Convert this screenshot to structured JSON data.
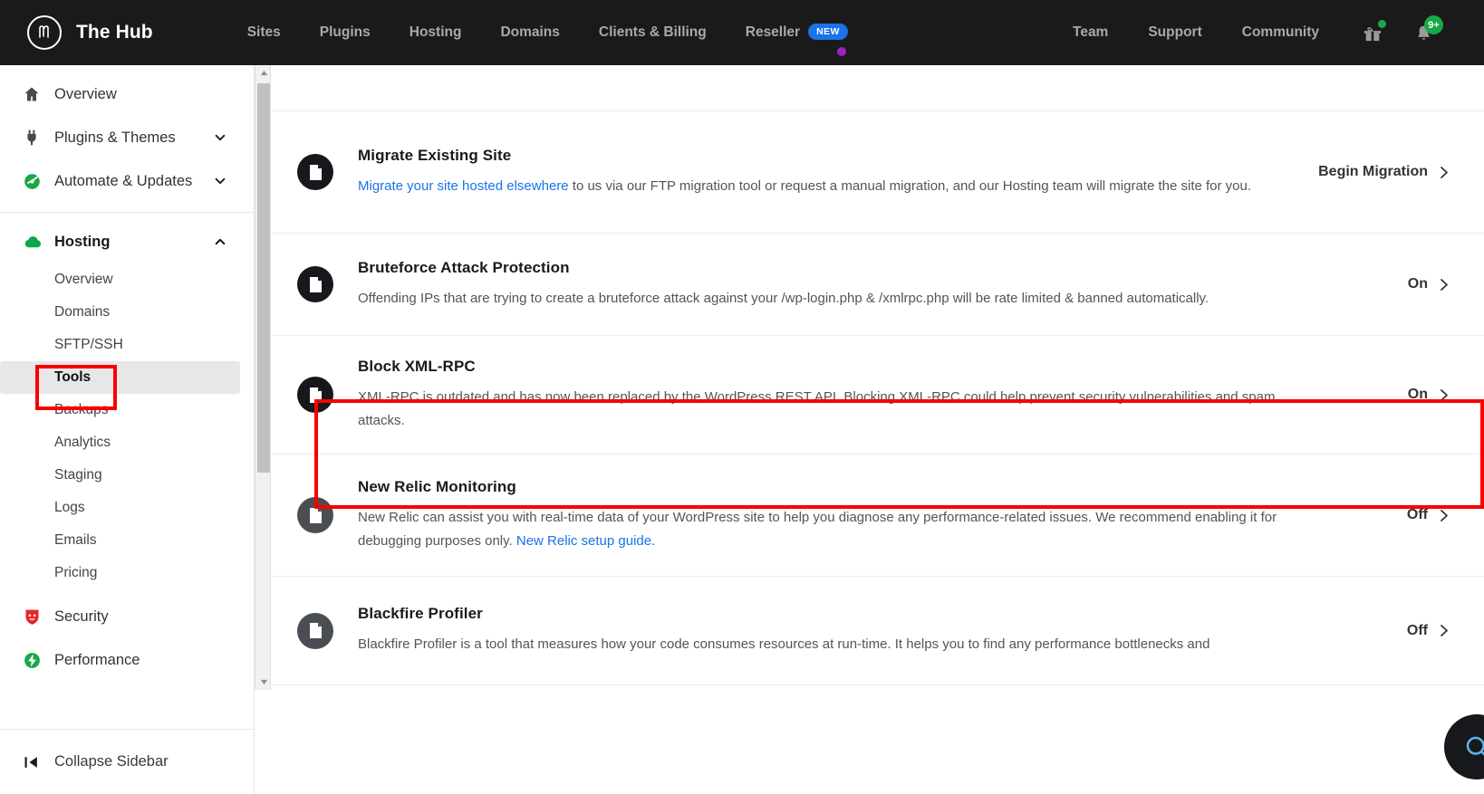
{
  "header": {
    "brand": "The Hub",
    "logo_icon": "hub-logo-icon",
    "nav": [
      {
        "label": "Sites"
      },
      {
        "label": "Plugins"
      },
      {
        "label": "Hosting"
      },
      {
        "label": "Domains"
      },
      {
        "label": "Clients & Billing"
      },
      {
        "label": "Reseller",
        "badge": "NEW",
        "dot": true
      }
    ],
    "nav_right": [
      {
        "label": "Team"
      },
      {
        "label": "Support"
      },
      {
        "label": "Community"
      }
    ],
    "gift_icon": "gift-icon",
    "bell_icon": "bell-icon",
    "notification_count": "9+",
    "menu_icon": "hamburger-menu-icon",
    "bg_color": "#1a1a1a",
    "badge_color": "#1a73e8",
    "notification_color": "#17a948"
  },
  "sidebar": {
    "top_items": [
      {
        "label": "Overview",
        "icon": "home-icon",
        "chevron": null
      },
      {
        "label": "Plugins & Themes",
        "icon": "plug-icon",
        "chevron": "chevron-down-icon"
      },
      {
        "label": "Automate & Updates",
        "icon": "automate-icon",
        "chevron": "chevron-down-icon"
      }
    ],
    "hosting": {
      "label": "Hosting",
      "icon": "cloud-icon",
      "chevron": "chevron-up-icon",
      "sub_items": [
        {
          "label": "Overview",
          "active": false
        },
        {
          "label": "Domains",
          "active": false
        },
        {
          "label": "SFTP/SSH",
          "active": false
        },
        {
          "label": "Tools",
          "active": true
        },
        {
          "label": "Backups",
          "active": false
        },
        {
          "label": "Analytics",
          "active": false
        },
        {
          "label": "Staging",
          "active": false
        },
        {
          "label": "Logs",
          "active": false
        },
        {
          "label": "Emails",
          "active": false
        },
        {
          "label": "Pricing",
          "active": false
        }
      ]
    },
    "bottom_items": [
      {
        "label": "Security",
        "icon": "shield-icon"
      },
      {
        "label": "Performance",
        "icon": "performance-icon"
      }
    ],
    "collapse": {
      "label": "Collapse Sidebar",
      "icon": "collapse-sidebar-icon"
    }
  },
  "main": {
    "rows": [
      {
        "name": "migrate-existing-site",
        "icon": "file-icon",
        "icon_state": "on",
        "title": "Migrate Existing Site",
        "desc_link": "Migrate your site hosted elsewhere",
        "desc_rest": " to us via our FTP migration tool or request a manual migration, and our Hosting team will migrate the site for you.",
        "action": "Begin Migration"
      },
      {
        "name": "bruteforce-attack-protection",
        "icon": "file-icon",
        "icon_state": "on",
        "title": "Bruteforce Attack Protection",
        "desc_link": null,
        "desc_rest": "Offending IPs that are trying to create a bruteforce attack against your /wp-login.php & /xmlrpc.php will be rate limited & banned automatically.",
        "action": "On"
      },
      {
        "name": "block-xml-rpc",
        "icon": "file-icon",
        "icon_state": "on",
        "title": "Block XML-RPC",
        "desc_link": null,
        "desc_rest": "XML-RPC is outdated and has now been replaced by the WordPress REST API. Blocking XML-RPC could help prevent security vulnerabilities and spam attacks.",
        "action": "On",
        "highlighted": true
      },
      {
        "name": "new-relic-monitoring",
        "icon": "file-icon",
        "icon_state": "off",
        "title": "New Relic Monitoring",
        "desc_link": null,
        "desc_rest": "New Relic can assist you with real-time data of your WordPress site to help you diagnose any performance-related issues. We recommend enabling it for debugging purposes only. ",
        "desc_link_tail": "New Relic setup guide",
        "desc_tail_end": ".",
        "action": "Off"
      },
      {
        "name": "blackfire-profiler",
        "icon": "file-icon",
        "icon_state": "off",
        "title": "Blackfire Profiler",
        "desc_link": null,
        "desc_rest": "Blackfire Profiler is a tool that measures how your code consumes resources at run-time. It helps you to find any performance bottlenecks and",
        "action": "Off"
      }
    ],
    "chevron_icon": "chevron-right-icon",
    "highlight_color": "#f90000"
  },
  "fab": {
    "icon": "chat-support-icon"
  }
}
